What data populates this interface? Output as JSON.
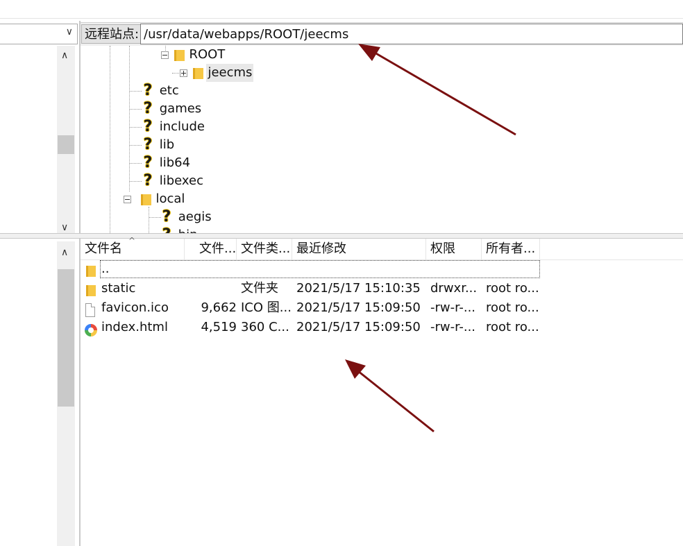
{
  "local_panel": {
    "path_value": "",
    "dropdown_icon": "chevron-down-icon"
  },
  "remote_panel": {
    "label": "远程站点:",
    "path_value": "/usr/data/webapps/ROOT/jeecms",
    "tree": [
      {
        "label": "ROOT",
        "icon": "folder-icon",
        "toggle": "minus",
        "depth": 2
      },
      {
        "label": "jeecms",
        "icon": "folder-icon",
        "toggle": "plus",
        "depth": 3,
        "selected": true
      },
      {
        "label": "etc",
        "icon": "question-icon",
        "depth": 1
      },
      {
        "label": "games",
        "icon": "question-icon",
        "depth": 1
      },
      {
        "label": "include",
        "icon": "question-icon",
        "depth": 1
      },
      {
        "label": "lib",
        "icon": "question-icon",
        "depth": 1
      },
      {
        "label": "lib64",
        "icon": "question-icon",
        "depth": 1
      },
      {
        "label": "libexec",
        "icon": "question-icon",
        "depth": 1
      },
      {
        "label": "local",
        "icon": "folder-icon",
        "toggle": "minus",
        "depth": 1
      },
      {
        "label": "aegis",
        "icon": "question-icon",
        "depth": 2
      },
      {
        "label": "bin",
        "icon": "question-icon",
        "depth": 2
      }
    ],
    "file_list": {
      "columns": [
        "文件名",
        "文件...",
        "文件类...",
        "最近修改",
        "权限",
        "所有者..."
      ],
      "parent_dir": "..",
      "rows": [
        {
          "name": "static",
          "icon": "folder-icon",
          "size": "",
          "type": "文件夹",
          "modified": "2021/5/17 15:10:35",
          "perms": "drwxr...",
          "owner": "root ro..."
        },
        {
          "name": "favicon.ico",
          "icon": "file-icon",
          "size": "9,662",
          "type": "ICO 图...",
          "modified": "2021/5/17 15:09:50",
          "perms": "-rw-r-...",
          "owner": "root ro..."
        },
        {
          "name": "index.html",
          "icon": "browser-icon",
          "size": "4,519",
          "type": "360 C...",
          "modified": "2021/5/17 15:09:50",
          "perms": "-rw-r-...",
          "owner": "root ro..."
        }
      ]
    }
  },
  "annotation_color": "#7a1010"
}
